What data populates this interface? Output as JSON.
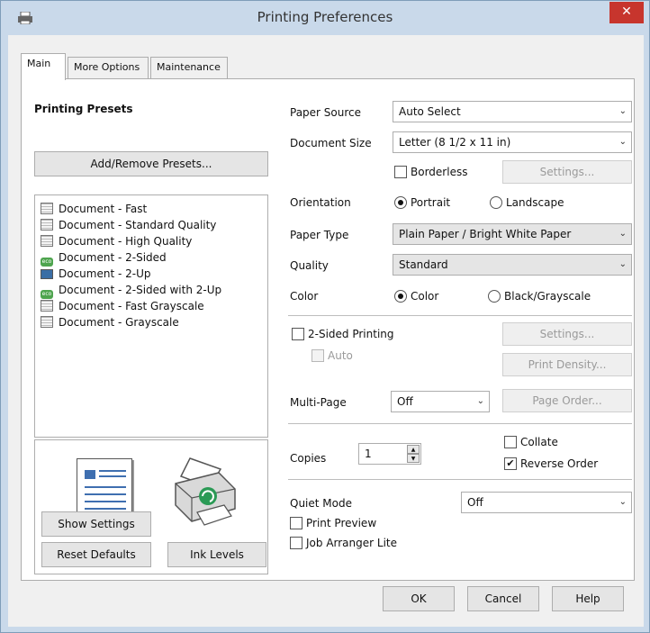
{
  "window": {
    "title": "Printing Preferences",
    "close_glyph": "✕"
  },
  "tabs": [
    {
      "label": "Main"
    },
    {
      "label": "More Options"
    },
    {
      "label": "Maintenance"
    }
  ],
  "presets": {
    "heading": "Printing Presets",
    "add_remove_button": "Add/Remove Presets...",
    "items": [
      {
        "label": "Document - Fast",
        "icon": "document-icon"
      },
      {
        "label": "Document - Standard Quality",
        "icon": "document-icon"
      },
      {
        "label": "Document - High Quality",
        "icon": "document-icon"
      },
      {
        "label": "Document - 2-Sided",
        "icon": "eco-icon"
      },
      {
        "label": "Document - 2-Up",
        "icon": "two-up-icon"
      },
      {
        "label": "Document - 2-Sided with 2-Up",
        "icon": "eco-icon"
      },
      {
        "label": "Document - Fast Grayscale",
        "icon": "document-icon"
      },
      {
        "label": "Document - Grayscale",
        "icon": "document-icon"
      }
    ],
    "eco_text": "eco"
  },
  "left_buttons": {
    "show_settings": "Show Settings",
    "reset_defaults": "Reset Defaults",
    "ink_levels": "Ink Levels"
  },
  "settings": {
    "paper_source_label": "Paper Source",
    "paper_source_value": "Auto Select",
    "document_size_label": "Document Size",
    "document_size_value": "Letter (8 1/2 x 11 in)",
    "borderless_label": "Borderless",
    "borderless_settings_button": "Settings...",
    "orientation_label": "Orientation",
    "orientation_portrait": "Portrait",
    "orientation_landscape": "Landscape",
    "paper_type_label": "Paper Type",
    "paper_type_value": "Plain Paper / Bright White Paper",
    "quality_label": "Quality",
    "quality_value": "Standard",
    "color_label": "Color",
    "color_color": "Color",
    "color_black": "Black/Grayscale",
    "two_sided_label": "2-Sided Printing",
    "two_sided_settings_button": "Settings...",
    "auto_label": "Auto",
    "print_density_button": "Print Density...",
    "multi_page_label": "Multi-Page",
    "multi_page_value": "Off",
    "page_order_button": "Page Order...",
    "copies_label": "Copies",
    "copies_value": "1",
    "collate_label": "Collate",
    "reverse_order_label": "Reverse Order",
    "quiet_mode_label": "Quiet Mode",
    "quiet_mode_value": "Off",
    "print_preview_label": "Print Preview",
    "job_arranger_label": "Job Arranger Lite"
  },
  "state": {
    "orientation": "Portrait",
    "color": "Color",
    "borderless_checked": false,
    "two_sided_checked": false,
    "collate_checked": false,
    "reverse_order_checked": true,
    "print_preview_checked": false,
    "job_arranger_checked": false
  },
  "footer": {
    "ok": "OK",
    "cancel": "Cancel",
    "help": "Help"
  },
  "dropdown_arrow": "⌄",
  "check_glyph": "✔"
}
